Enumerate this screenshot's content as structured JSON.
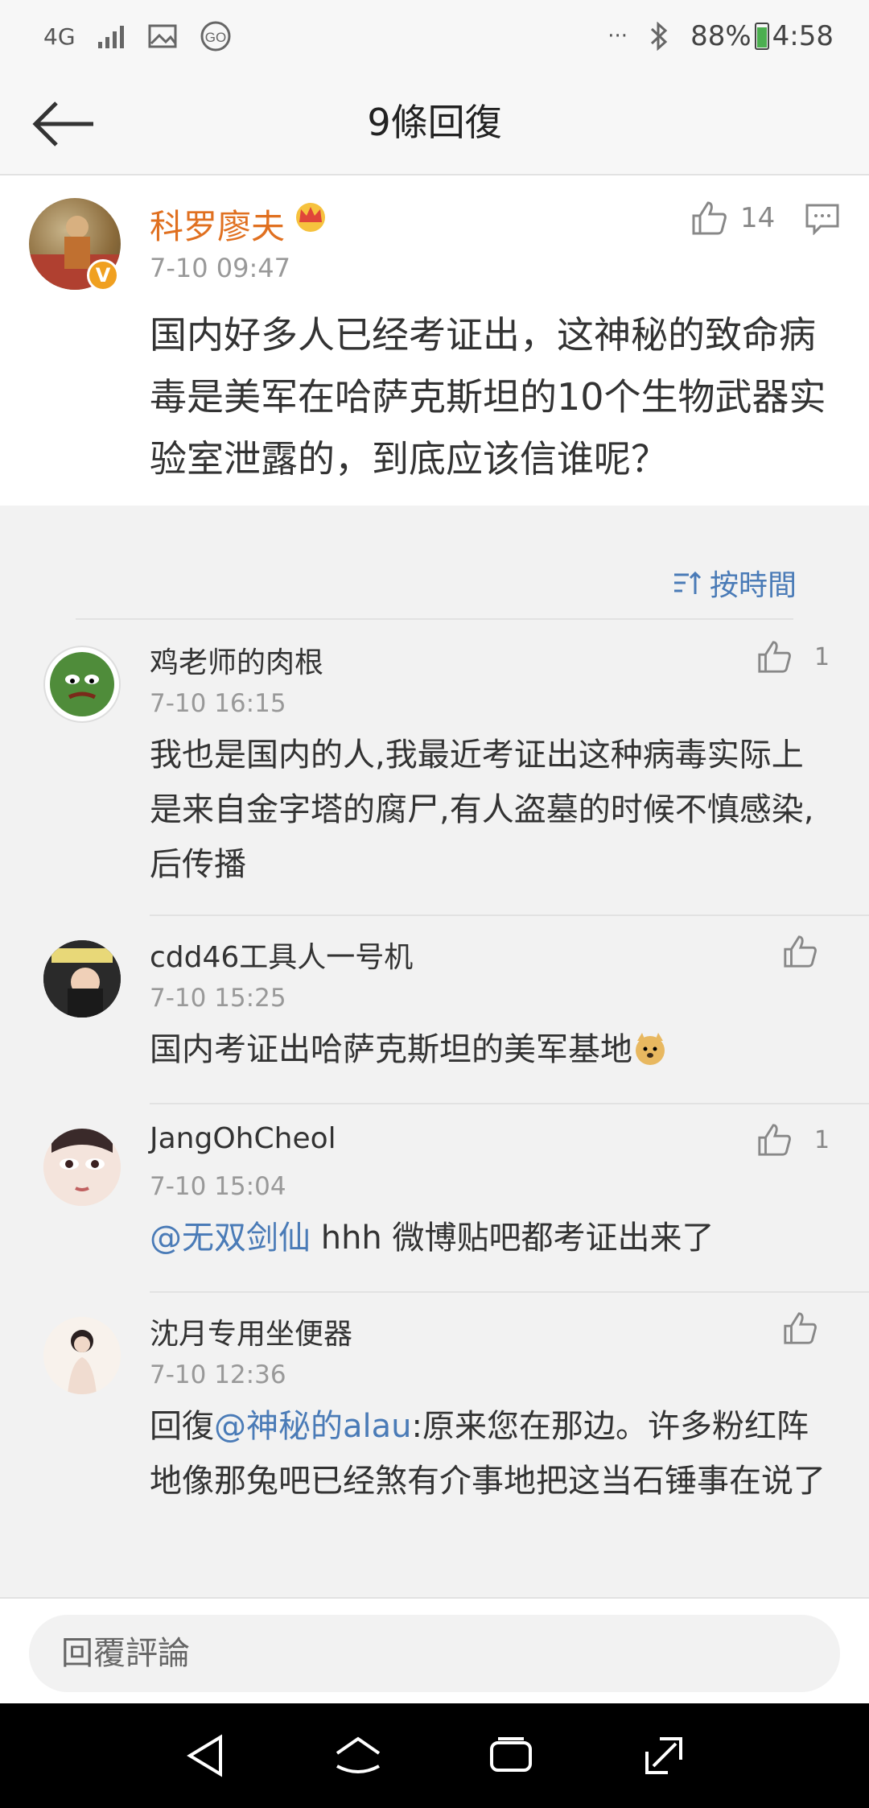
{
  "status_bar": {
    "network": "4G",
    "battery_percent": "88%",
    "time": "4:58",
    "overflow": "···"
  },
  "header": {
    "title": "9條回復"
  },
  "post": {
    "author": "科罗廖夫",
    "verified_badge": "V",
    "time": "7-10 09:47",
    "likes": "14",
    "text": "国内好多人已经考证出，这神秘的致命病毒是美军在哈萨克斯坦的10个生物武器实验室泄露的，到底应该信谁呢？"
  },
  "sort": {
    "label": "按時間"
  },
  "comments": [
    {
      "name": "鸡老师的肉根",
      "time": "7-10 16:15",
      "likes": "1",
      "text": "我也是国内的人,我最近考证出这种病毒实际上是来自金字塔的腐尸,有人盗墓的时候不慎感染,后传播"
    },
    {
      "name": "cdd46工具人一号机",
      "time": "7-10 15:25",
      "likes": "",
      "text": "国内考证出哈萨克斯坦的美军基地"
    },
    {
      "name": "JangOhCheol",
      "time": "7-10 15:04",
      "likes": "1",
      "mention": "@无双剑仙",
      "text": " hhh 微博贴吧都考证出来了"
    },
    {
      "name": "沈月专用坐便器",
      "time": "7-10 12:36",
      "likes": "",
      "prefix": "回復",
      "mention": "@神秘的alau",
      "text": ":原来您在那边。许多粉红阵地像那兔吧已经煞有介事地把这当石锤事在说了"
    }
  ],
  "reply": {
    "placeholder": "回覆評論"
  },
  "colors": {
    "accent_blue": "#4a7bb7",
    "author_orange": "#e07020",
    "verified_gold": "#f0a020"
  },
  "icons": {
    "back": "arrow-left-icon",
    "like": "thumb-up-icon",
    "comment": "comment-bubble-icon",
    "sort": "sort-icon",
    "crown": "crown-icon",
    "nav_back": "nav-back-icon",
    "nav_home": "nav-home-icon",
    "nav_recent": "nav-recent-icon",
    "nav_expand": "nav-expand-icon"
  }
}
